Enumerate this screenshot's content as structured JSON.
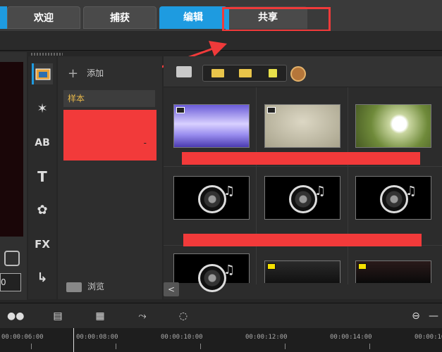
{
  "tabs": [
    {
      "label": "欢迎"
    },
    {
      "label": "捕获"
    },
    {
      "label": "编辑"
    },
    {
      "label": "共享"
    }
  ],
  "active_tab": "编辑",
  "annotation_color": "#f03a3a",
  "accent_color": "#1e9be0",
  "preview": {
    "counter_value": "0"
  },
  "tools": [
    {
      "icon": "media-library-icon"
    },
    {
      "icon": "transition-icon",
      "text": "✶"
    },
    {
      "icon": "title-ab-icon",
      "text": "AB"
    },
    {
      "icon": "text-t-icon",
      "text": "T"
    },
    {
      "icon": "graphics-flower-icon",
      "text": "✿"
    },
    {
      "icon": "fx-filter-icon",
      "text": "FX"
    },
    {
      "icon": "path-motion-icon",
      "text": "↳"
    }
  ],
  "library": {
    "add_label": "添加",
    "selected_item": "样本",
    "browse_label": "浏览"
  },
  "media_toolbar": {
    "filters": [
      "video-filter-icon",
      "photo-filter-icon",
      "audio-filter-icon"
    ]
  },
  "scroll_left": "<",
  "timeline": {
    "ticks": [
      "00:00:06:00",
      "00:00:08:00",
      "00:00:10:00",
      "00:00:12:00",
      "00:00:14:00",
      "00:00:16"
    ]
  }
}
